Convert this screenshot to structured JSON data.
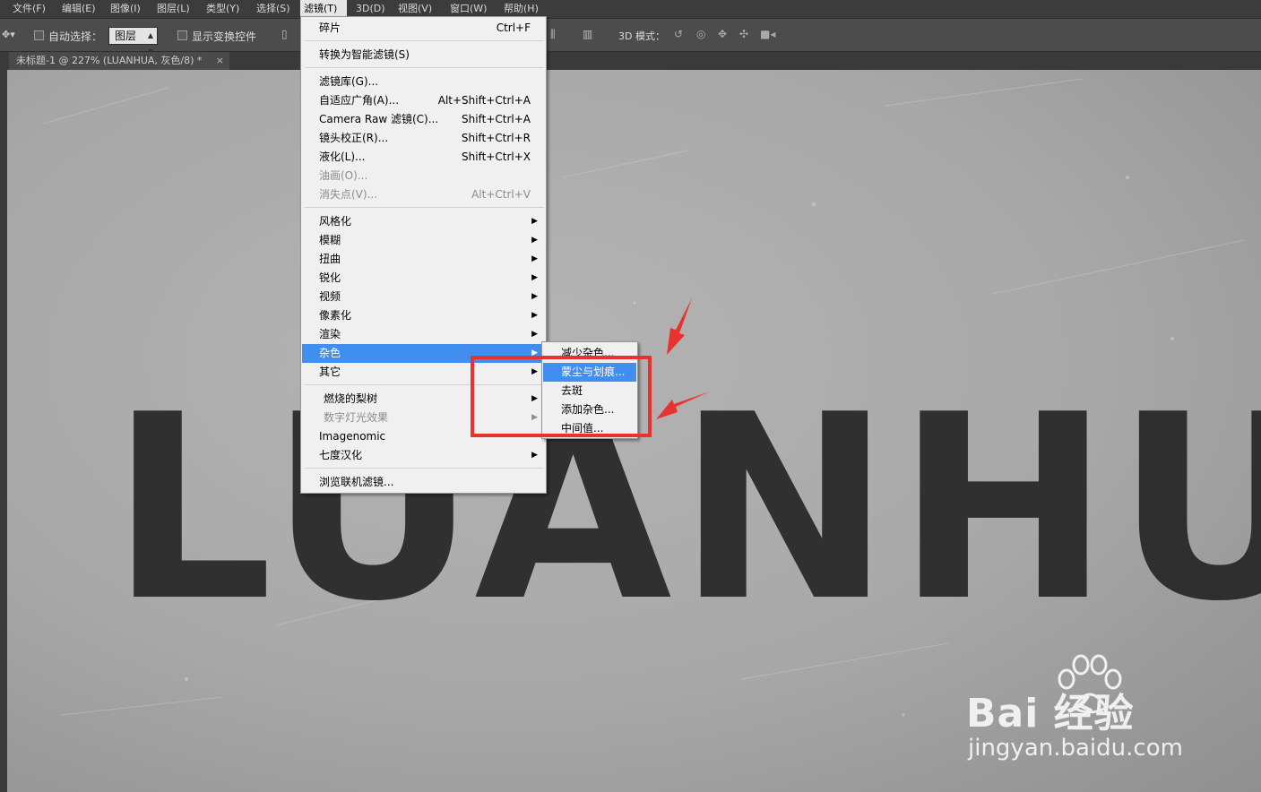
{
  "menubar": {
    "items": [
      "文件(F)",
      "编辑(E)",
      "图像(I)",
      "图层(L)",
      "类型(Y)",
      "选择(S)",
      "滤镜(T)",
      "3D(D)",
      "视图(V)",
      "窗口(W)",
      "帮助(H)"
    ]
  },
  "options": {
    "auto_select_label": "自动选择：",
    "auto_select_value": "图层",
    "show_transform_label": "显示变换控件",
    "mode_3d_label": "3D 模式："
  },
  "document_tab": {
    "title": "未标题-1 @ 227% (LUANHUA, 灰色/8) *",
    "close": "×"
  },
  "canvas": {
    "text": "LUANHUA"
  },
  "filter_menu": {
    "last_filter": {
      "label": "碎片",
      "shortcut": "Ctrl+F"
    },
    "convert_smart": "转换为智能滤镜(S)",
    "filter_gallery": "滤镜库(G)...",
    "adaptive_wide": {
      "label": "自适应广角(A)...",
      "shortcut": "Alt+Shift+Ctrl+A"
    },
    "camera_raw": {
      "label": "Camera Raw 滤镜(C)...",
      "shortcut": "Shift+Ctrl+A"
    },
    "lens_correction": {
      "label": "镜头校正(R)...",
      "shortcut": "Shift+Ctrl+R"
    },
    "liquify": {
      "label": "液化(L)...",
      "shortcut": "Shift+Ctrl+X"
    },
    "oil_paint": "油画(O)...",
    "vanishing_point": {
      "label": "消失点(V)...",
      "shortcut": "Alt+Ctrl+V"
    },
    "stylize": "风格化",
    "blur": "模糊",
    "distort": "扭曲",
    "sharpen": "锐化",
    "video": "视频",
    "pixelate": "像素化",
    "render": "渲染",
    "noise": "杂色",
    "other": "其它",
    "burning_pear": "燃烧的梨树",
    "digital_light": "数字灯光效果",
    "imagenomic": "Imagenomic",
    "qidu": "七度汉化",
    "browse_online": "浏览联机滤镜..."
  },
  "noise_submenu": {
    "reduce_noise": "减少杂色...",
    "dust_scratches": "蒙尘与划痕...",
    "despeckle": "去斑",
    "add_noise": "添加杂色...",
    "median": "中间值..."
  },
  "watermark": {
    "brand": "Bai 经验",
    "url": "jingyan.baidu.com"
  },
  "colors": {
    "highlight": "#3f8ef0",
    "annotation": "#e8322f"
  }
}
